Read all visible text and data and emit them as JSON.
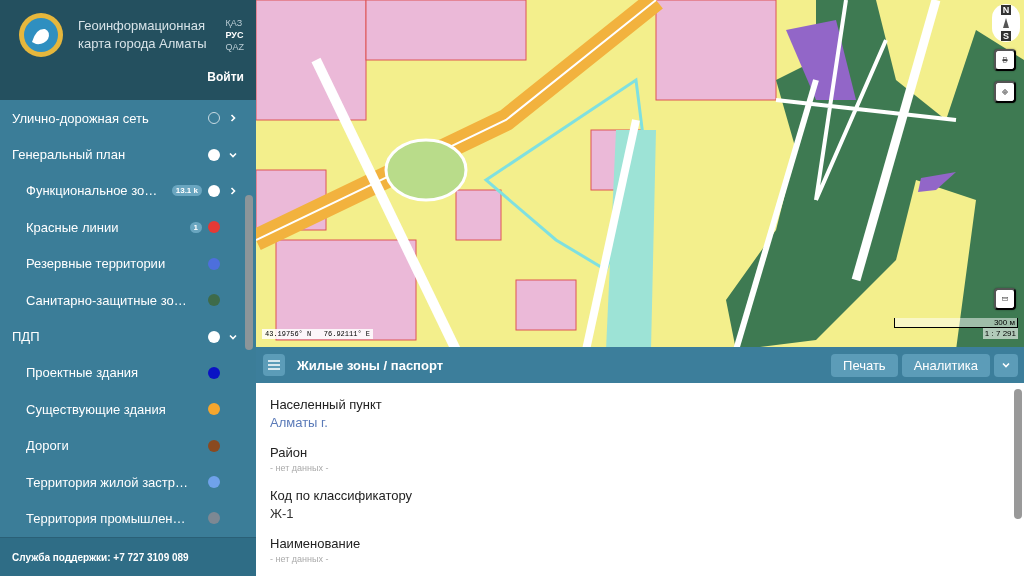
{
  "header": {
    "title_line1": "Геоинформационная",
    "title_line2": "карта города Алматы",
    "login": "Войти"
  },
  "languages": [
    {
      "label": "ҚАЗ",
      "selected": false
    },
    {
      "label": "РУС",
      "selected": true
    },
    {
      "label": "QAZ",
      "selected": false
    }
  ],
  "layers": [
    {
      "kind": "group",
      "label": "Улично-дорожная сеть",
      "on": false,
      "expanded": false
    },
    {
      "kind": "group",
      "label": "Генеральный план",
      "on": true,
      "expanded": true,
      "children": [
        {
          "kind": "group",
          "label": "Функциональное зо…",
          "badge": "13.1 k",
          "on": true,
          "expanded": false
        },
        {
          "kind": "layer",
          "label": "Красные линии",
          "badge": "1",
          "color": "#e53935"
        },
        {
          "kind": "layer",
          "label": "Резервные территории",
          "color": "#4d6fdc"
        },
        {
          "kind": "layer",
          "label": "Санитарно-защитные зо…",
          "color": "#3e6b4a"
        }
      ]
    },
    {
      "kind": "group",
      "label": "ПДП",
      "on": true,
      "expanded": true,
      "children": [
        {
          "kind": "layer",
          "label": "Проектные здания",
          "color": "#0a12c4"
        },
        {
          "kind": "layer",
          "label": "Существующие здания",
          "color": "#f5a62e"
        },
        {
          "kind": "layer",
          "label": "Дороги",
          "color": "#8a4a20"
        },
        {
          "kind": "layer",
          "label": "Территория жилой застр…",
          "color": "#6fa2ea"
        },
        {
          "kind": "layer",
          "label": "Территория промышлен…",
          "color": "#7d8893"
        }
      ]
    }
  ],
  "support": "Служба поддержки: +7 727 3109 089",
  "map": {
    "compass_n": "N",
    "compass_s": "S",
    "coordinates": "43.19756° N   76.92111° E",
    "scale_distance": "300 м",
    "scale_ratio": "1 : 7 291"
  },
  "panel": {
    "title": "Жилые зоны / паспорт",
    "buttons": [
      "Печать",
      "Аналитика"
    ],
    "fields": [
      {
        "label": "Населенный пункт",
        "value": "Алматы г.",
        "kind": "link"
      },
      {
        "label": "Район",
        "value": "- нет данных -",
        "kind": "empty"
      },
      {
        "label": "Код по классификатору",
        "value": "Ж-1",
        "kind": "text"
      },
      {
        "label": "Наименование",
        "value": "- нет данных -",
        "kind": "empty"
      }
    ]
  }
}
